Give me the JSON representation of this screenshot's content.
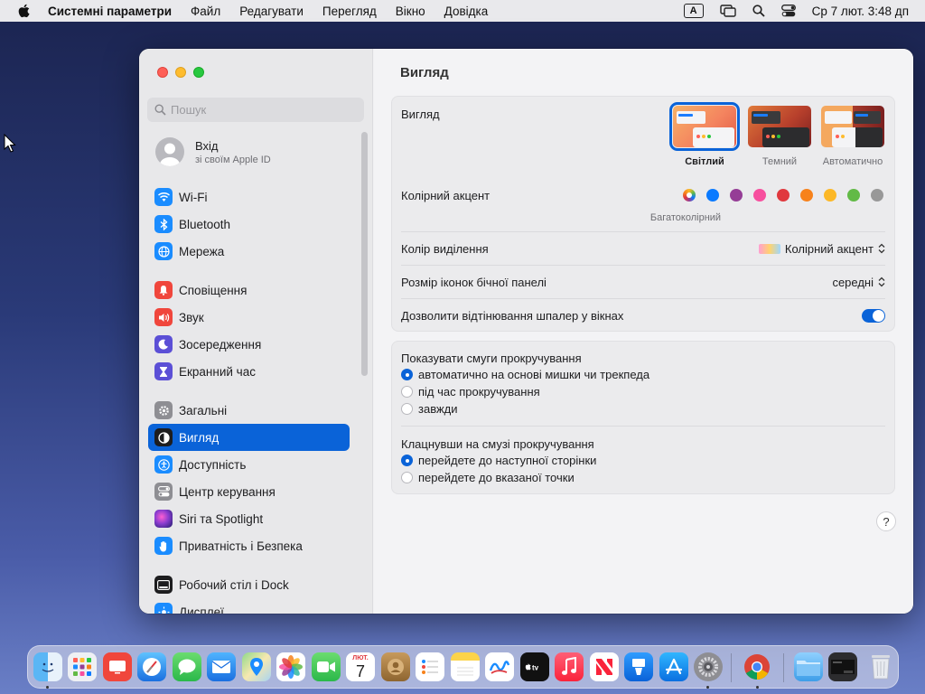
{
  "menubar": {
    "app_name": "Системні параметри",
    "items": [
      "Файл",
      "Редагувати",
      "Перегляд",
      "Вікно",
      "Довідка"
    ],
    "input_indicator": "A",
    "clock": "Ср 7 лют.  3:48 дп"
  },
  "sidebar": {
    "search_placeholder": "Пошук",
    "account": {
      "title": "Вхід",
      "subtitle": "зі своїм Apple ID"
    },
    "items": [
      {
        "label": "Wi-Fi",
        "icon": "wifi-icon",
        "color": "#1a8cff"
      },
      {
        "label": "Bluetooth",
        "icon": "bluetooth-icon",
        "color": "#1a8cff"
      },
      {
        "label": "Мережа",
        "icon": "globe-icon",
        "color": "#1a8cff"
      },
      {
        "label": "Сповіщення",
        "icon": "bell-icon",
        "color": "#f0463c"
      },
      {
        "label": "Звук",
        "icon": "speaker-icon",
        "color": "#f0463c"
      },
      {
        "label": "Зосередження",
        "icon": "moon-icon",
        "color": "#5b4fd6"
      },
      {
        "label": "Екранний час",
        "icon": "hourglass-icon",
        "color": "#5b4fd6"
      },
      {
        "label": "Загальні",
        "icon": "gear-icon",
        "color": "#8e8e93"
      },
      {
        "label": "Вигляд",
        "icon": "appearance-icon",
        "color": "#1d1d1f"
      },
      {
        "label": "Доступність",
        "icon": "accessibility-icon",
        "color": "#1a8cff"
      },
      {
        "label": "Центр керування",
        "icon": "control-center-icon",
        "color": "#8e8e93"
      },
      {
        "label": "Siri та Spotlight",
        "icon": "siri-icon",
        "color": "#8a3ccf"
      },
      {
        "label": "Приватність і Безпека",
        "icon": "hand-icon",
        "color": "#1a8cff"
      },
      {
        "label": "Робочий стіл і Dock",
        "icon": "dock-icon",
        "color": "#1d1d1f"
      },
      {
        "label": "Дисплеї",
        "icon": "display-icon",
        "color": "#1a8cff"
      }
    ],
    "selected_index": 8
  },
  "content": {
    "title": "Вигляд",
    "appearance": {
      "label": "Вигляд",
      "options": [
        "Світлий",
        "Темний",
        "Автоматично"
      ],
      "selected": "Світлий"
    },
    "accent": {
      "label": "Колірний акцент",
      "selected_caption": "Багатоколірний",
      "colors": [
        "multicolor",
        "#0a7aff",
        "#953d96",
        "#f74f9e",
        "#e0383e",
        "#f7821b",
        "#fcb827",
        "#62ba46",
        "#989898"
      ]
    },
    "highlight": {
      "label": "Колір виділення",
      "value": "Колірний акцент"
    },
    "sidebar_icon_size": {
      "label": "Розмір іконок бічної панелі",
      "value": "середні"
    },
    "tinting": {
      "label": "Дозволити відтінювання шпалер у вікнах",
      "on": true
    },
    "scrollbars": {
      "label": "Показувати смуги прокручування",
      "options": [
        "автоматично на основі мишки чи трекпеда",
        "під час прокручування",
        "завжди"
      ],
      "selected_index": 0
    },
    "click_scroll": {
      "label": "Клацнувши на смузі прокручування",
      "options": [
        "перейдете до наступної сторінки",
        "перейдете до вказаної точки"
      ],
      "selected_index": 0
    },
    "help": "?"
  },
  "dock": {
    "apps": [
      "Finder",
      "Launchpad",
      "TV",
      "Safari",
      "Messages",
      "Mail",
      "Maps",
      "Photos",
      "FaceTime",
      "Calendar",
      "Contacts",
      "Reminders",
      "Notes",
      "Freeform",
      "TV",
      "Music",
      "News",
      "Keynote",
      "App Store",
      "System Settings",
      "Chrome",
      "Downloads",
      "Screenshot",
      "Trash"
    ],
    "calendar": {
      "month": "ЛЮТ.",
      "day": "7"
    }
  }
}
